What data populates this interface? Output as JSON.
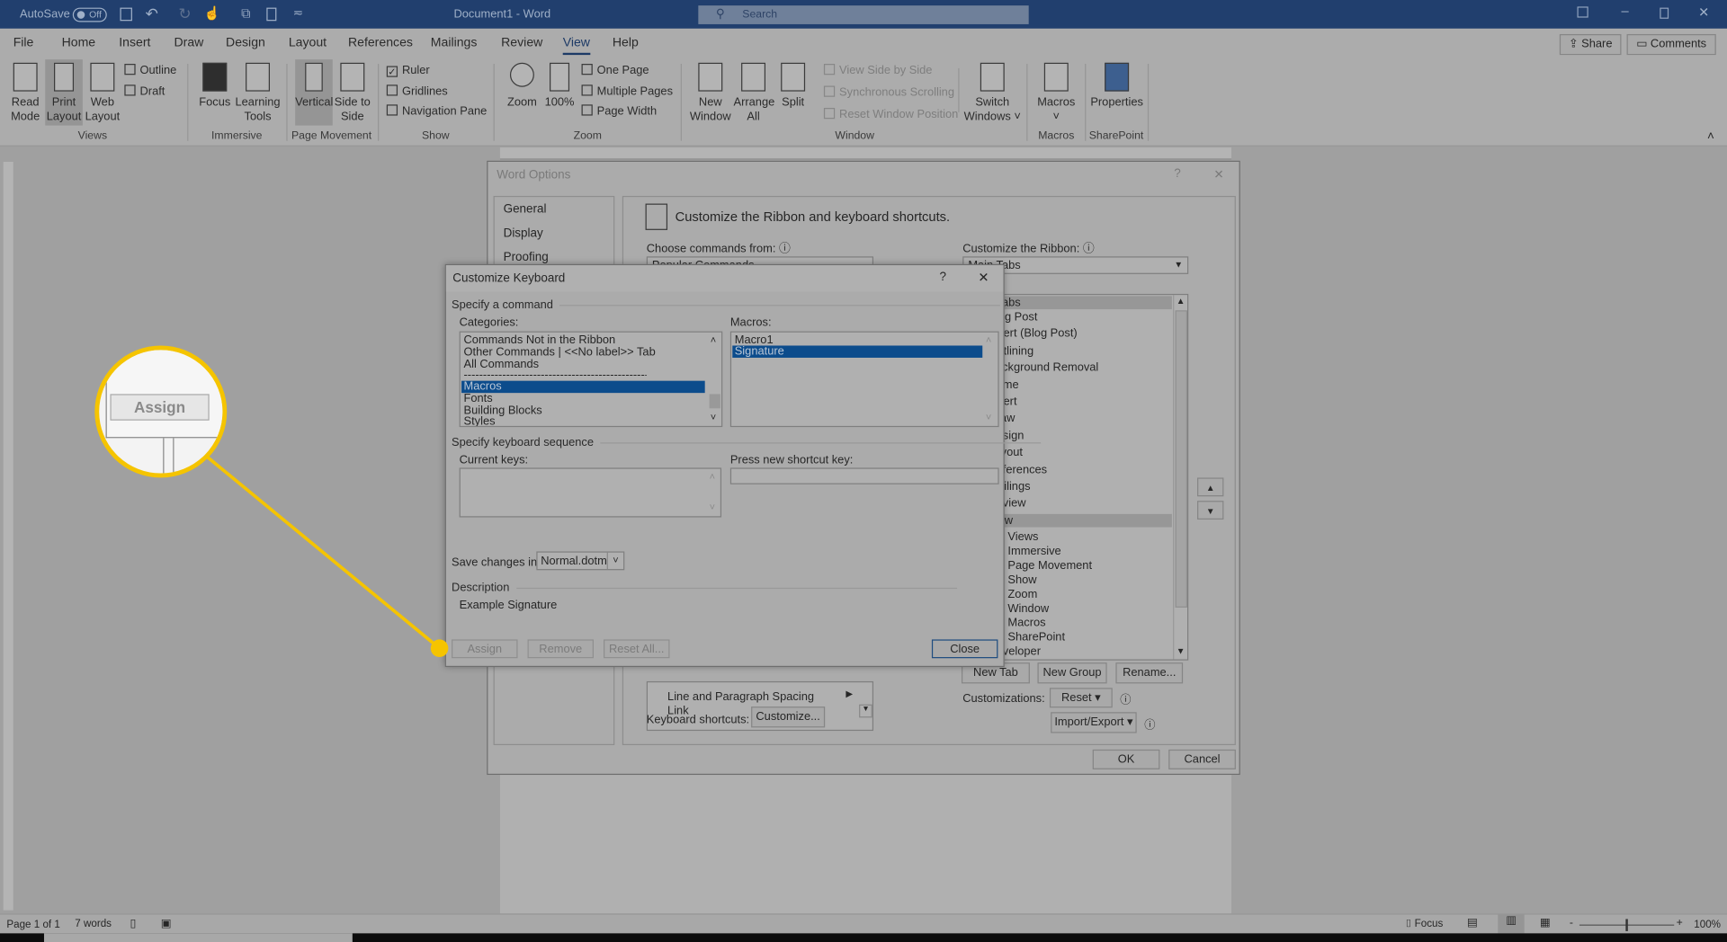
{
  "titlebar": {
    "autosave": "AutoSave",
    "autosave_state": "Off",
    "doc_title": "Document1 - Word",
    "search_placeholder": "Search",
    "colors": {
      "bar": "#213f6e"
    }
  },
  "tabs": [
    "File",
    "Home",
    "Insert",
    "Draw",
    "Design",
    "Layout",
    "References",
    "Mailings",
    "Review",
    "View",
    "Help"
  ],
  "active_tab": "View",
  "share": "Share",
  "comments": "Comments",
  "ribbon": {
    "views": {
      "label": "Views",
      "read_mode": "Read Mode",
      "print_layout": "Print Layout",
      "web_layout": "Web Layout",
      "outline": "Outline",
      "draft": "Draft"
    },
    "immersive": {
      "label": "Immersive",
      "focus": "Focus",
      "learning_tools": "Learning Tools"
    },
    "page_movement": {
      "label": "Page Movement",
      "vertical": "Vertical",
      "side_to_side": "Side to Side"
    },
    "show": {
      "label": "Show",
      "ruler": "Ruler",
      "ruler_checked": true,
      "gridlines": "Gridlines",
      "gridlines_checked": false,
      "navigation_pane": "Navigation Pane",
      "navigation_pane_checked": false
    },
    "zoom": {
      "label": "Zoom",
      "zoom": "Zoom",
      "hundred": "100%",
      "one_page": "One Page",
      "multiple_pages": "Multiple Pages",
      "page_width": "Page Width"
    },
    "window": {
      "label": "Window",
      "new_window": "New Window",
      "arrange_all": "Arrange All",
      "split": "Split",
      "side_by_side": "View Side by Side",
      "sync_scrolling": "Synchronous Scrolling",
      "reset_position": "Reset Window Position",
      "switch_windows": "Switch Windows"
    },
    "macros": {
      "label": "Macros",
      "macros": "Macros"
    },
    "sharepoint": {
      "label": "SharePoint",
      "properties": "Properties"
    }
  },
  "word_options": {
    "title": "Word Options",
    "nav": [
      "General",
      "Display",
      "Proofing"
    ],
    "header": "Customize the Ribbon and keyboard shortcuts.",
    "choose_commands_label": "Choose commands from:",
    "choose_commands_value": "Popular Commands",
    "customize_ribbon_label": "Customize the Ribbon:",
    "customize_ribbon_value": "Main Tabs",
    "commands_visible": [
      "Line and Paragraph Spacing",
      "Link"
    ],
    "ribbon_tabs": [
      "Main Tabs",
      "Blog Post",
      "Insert (Blog Post)",
      "Outlining",
      "Background Removal",
      "Home",
      "Insert",
      "Draw",
      "Design",
      "Layout",
      "References",
      "Mailings",
      "Review",
      "View"
    ],
    "view_groups": [
      "Views",
      "Immersive",
      "Page Movement",
      "Show",
      "Zoom",
      "Window",
      "Macros",
      "SharePoint"
    ],
    "ribbon_tabs_after": [
      "Developer"
    ],
    "keyboard_shortcuts_label": "Keyboard shortcuts:",
    "customize_button": "Customize...",
    "new_tab": "New Tab",
    "new_group": "New Group",
    "rename": "Rename...",
    "customizations_label": "Customizations:",
    "reset": "Reset ▾",
    "import_export": "Import/Export ▾",
    "ok": "OK",
    "cancel": "Cancel"
  },
  "customize_keyboard": {
    "title": "Customize Keyboard",
    "specify_command": "Specify a command",
    "categories_label": "Categories:",
    "categories": [
      "Commands Not in the Ribbon",
      "Other Commands | <<No label>> Tab",
      "All Commands",
      "---------------------------------------------------",
      "Macros",
      "Fonts",
      "Building Blocks",
      "Styles"
    ],
    "categories_selected": "Macros",
    "macros_label": "Macros:",
    "macros": [
      "Macro1",
      "Signature"
    ],
    "macros_selected": "Signature",
    "specify_sequence": "Specify keyboard sequence",
    "current_keys_label": "Current keys:",
    "press_new_label": "Press new shortcut key:",
    "save_changes_label": "Save changes in:",
    "save_changes_value": "Normal.dotm",
    "description_label": "Description",
    "description": "Example Signature",
    "assign": "Assign",
    "remove": "Remove",
    "reset_all": "Reset All...",
    "close": "Close"
  },
  "callout": {
    "label": "Assign",
    "color": "#f5c400"
  },
  "statusbar": {
    "page": "Page 1 of 1",
    "words": "7 words",
    "focus": "Focus",
    "zoom": "100%"
  }
}
